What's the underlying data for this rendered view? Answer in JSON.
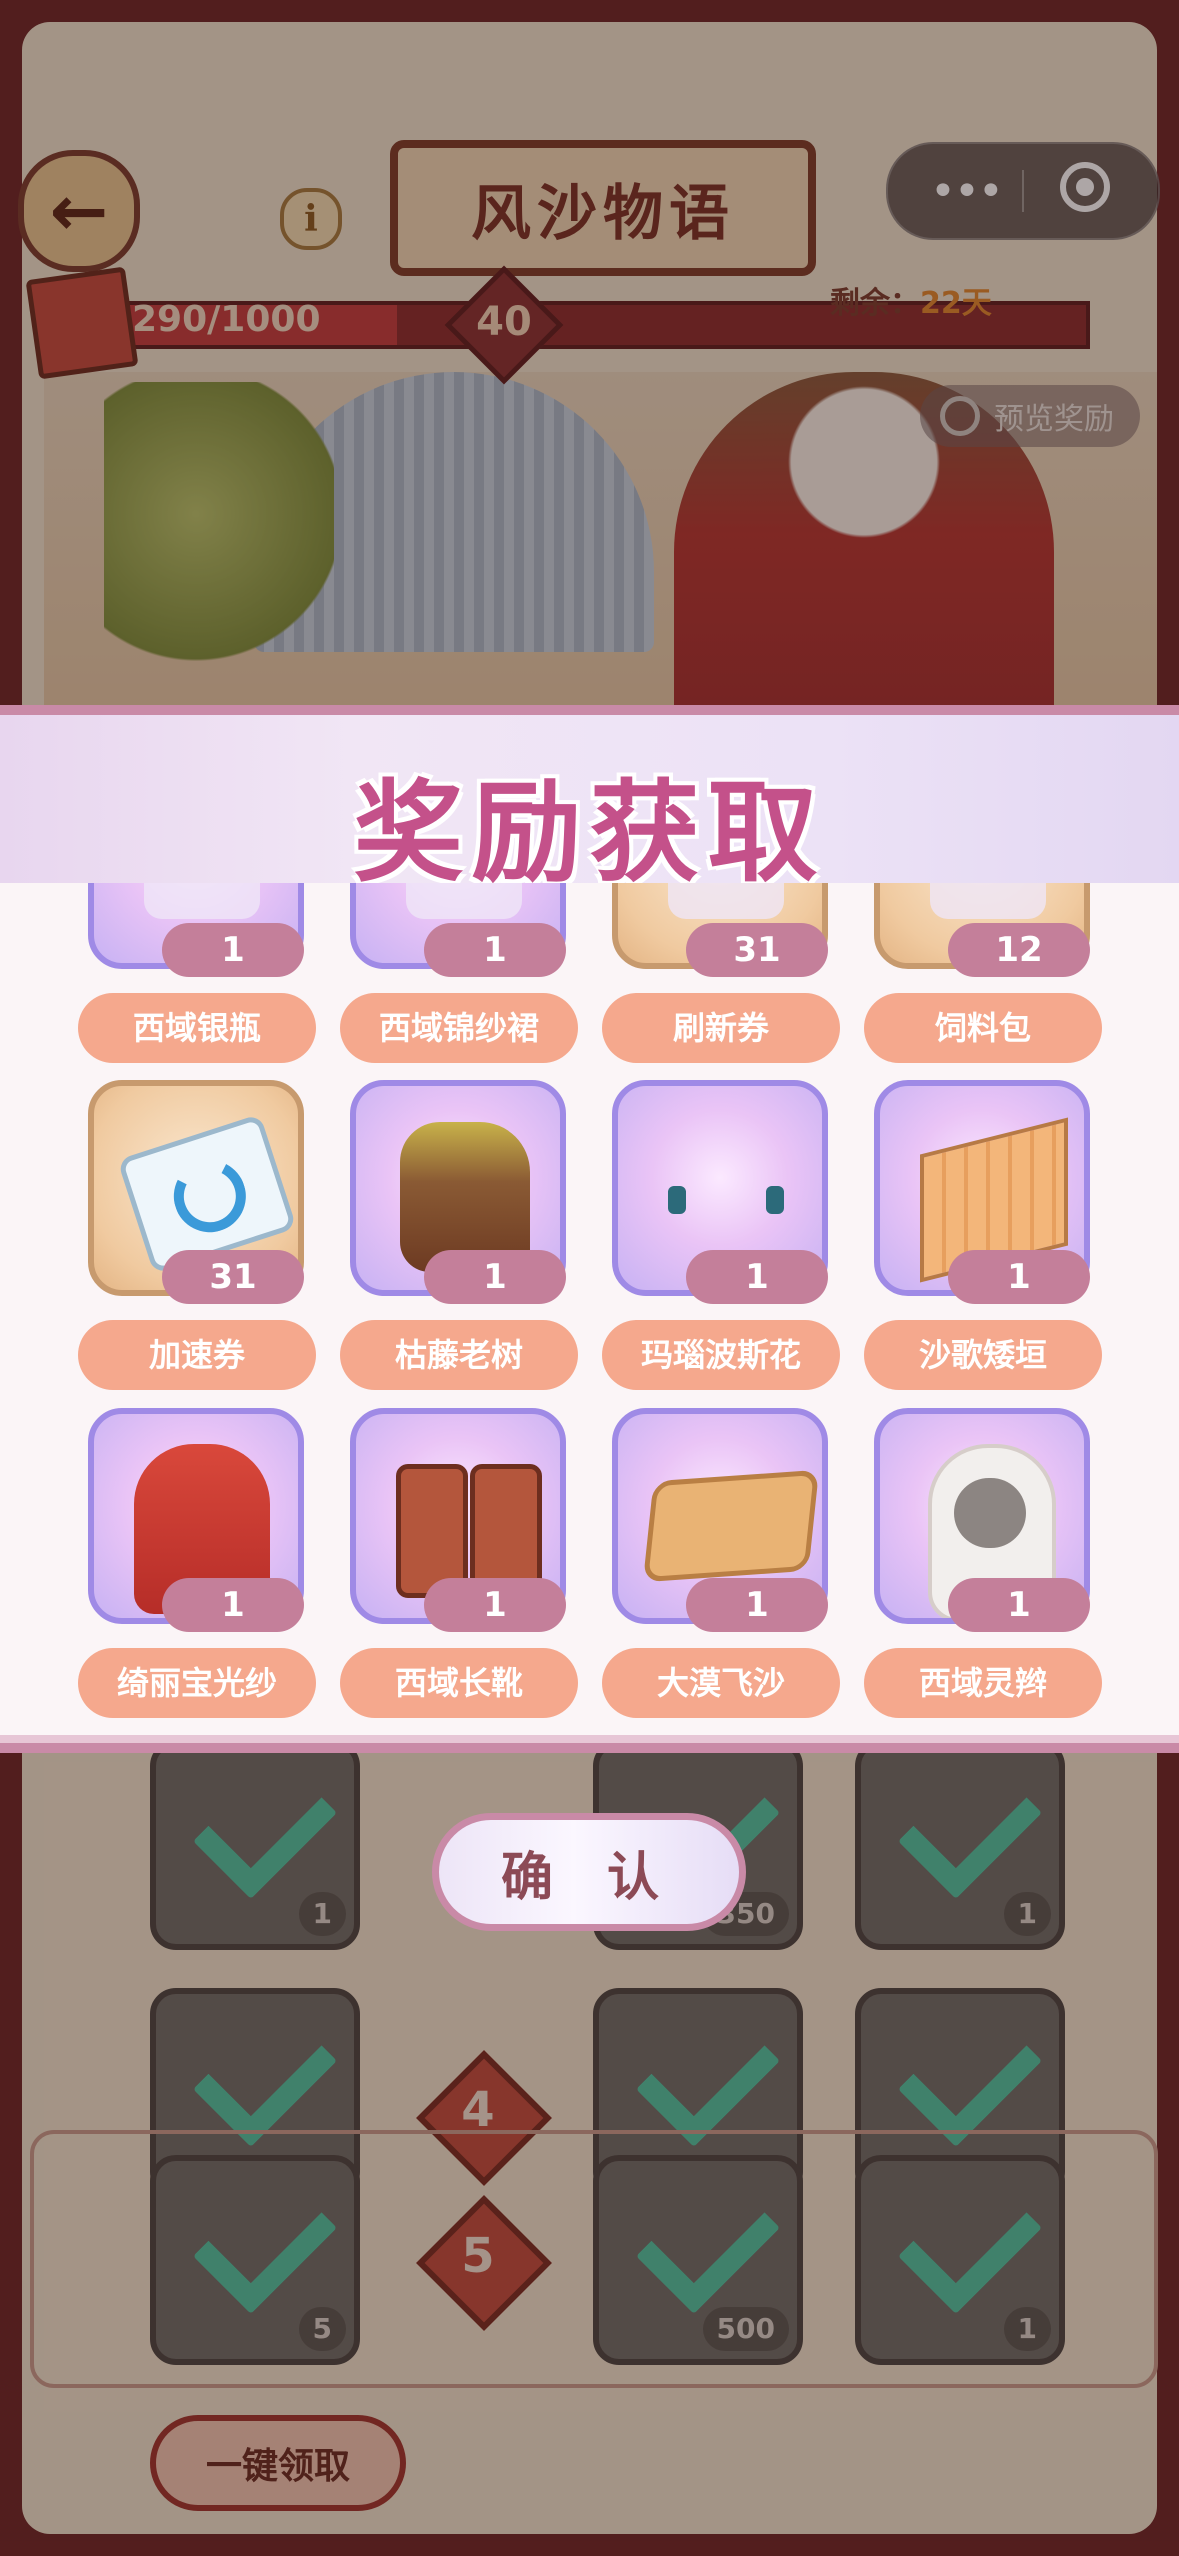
{
  "header": {
    "title": "风沙物语",
    "progress_text": "290/1000",
    "progress_fraction": 0.29,
    "level": "40",
    "remaining_label": "剩余：",
    "remaining_value": "22天",
    "preview_label": "预览奖励"
  },
  "capsule": {
    "more_icon": "more-dots-icon",
    "close_icon": "target-circle-icon"
  },
  "modal": {
    "title": "奖励获取",
    "confirm_label": "确 认",
    "items": [
      {
        "name": "西域银瓶",
        "qty": "1",
        "bg": "purple",
        "art": "vase"
      },
      {
        "name": "西域锦纱裙",
        "qty": "1",
        "bg": "purple",
        "art": "skirt"
      },
      {
        "name": "刷新券",
        "qty": "31",
        "bg": "tan",
        "art": "refresh-ticket"
      },
      {
        "name": "饲料包",
        "qty": "12",
        "bg": "tan",
        "art": "feed-bag"
      },
      {
        "name": "加速券",
        "qty": "31",
        "bg": "tan",
        "art": "speed-ticket"
      },
      {
        "name": "枯藤老树",
        "qty": "1",
        "bg": "purple",
        "art": "tree"
      },
      {
        "name": "玛瑙波斯花",
        "qty": "1",
        "bg": "purple",
        "art": "earrings"
      },
      {
        "name": "沙歌矮垣",
        "qty": "1",
        "bg": "purple",
        "art": "wall"
      },
      {
        "name": "绮丽宝光纱",
        "qty": "1",
        "bg": "purple",
        "art": "veil"
      },
      {
        "name": "西域长靴",
        "qty": "1",
        "bg": "purple",
        "art": "boots"
      },
      {
        "name": "大漠飞沙",
        "qty": "1",
        "bg": "purple",
        "art": "sand-tile"
      },
      {
        "name": "西域灵辫",
        "qty": "1",
        "bg": "purple",
        "art": "braids"
      }
    ]
  },
  "reward_board": {
    "slot_quantities": [
      "1",
      "350",
      "1",
      "5",
      "500",
      "1"
    ],
    "tiers": [
      "4",
      "5"
    ],
    "claim_all_label": "一键领取"
  }
}
